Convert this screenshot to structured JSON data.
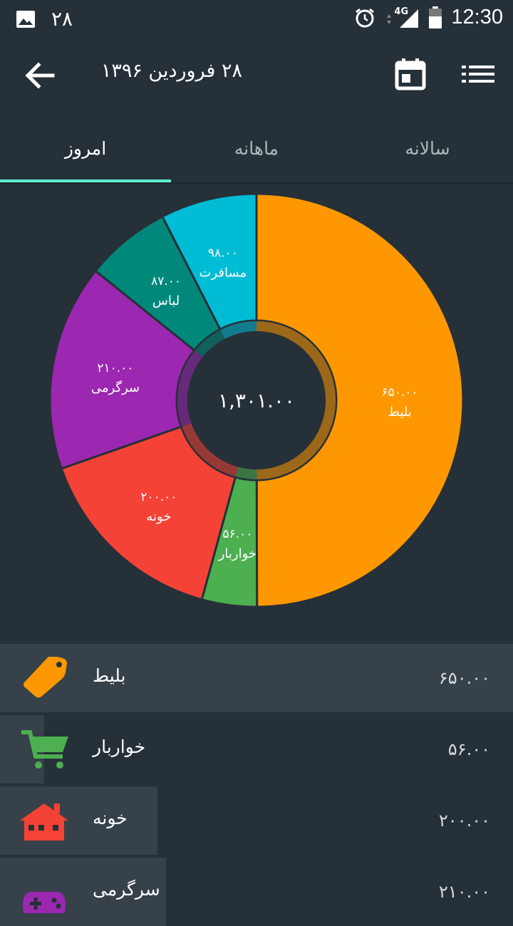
{
  "status_bar": {
    "notification_count": "۲۸",
    "network": "4G",
    "time": "12:30"
  },
  "app_bar": {
    "title": "۲۸ فروردین ۱۳۹۶"
  },
  "tabs": [
    {
      "label": "امروز",
      "active": true
    },
    {
      "label": "ماهانه",
      "active": false
    },
    {
      "label": "سالانه",
      "active": false
    }
  ],
  "chart_data": {
    "type": "pie",
    "center_label": "۱,۳۰۱.۰۰",
    "slices": [
      {
        "label": "بلیط",
        "value_label": "۶۵۰.۰۰",
        "value": 650,
        "color": "#FF9800"
      },
      {
        "label": "خواربار",
        "value_label": "۵۶.۰۰",
        "value": 56,
        "color": "#4CAF50"
      },
      {
        "label": "خونه",
        "value_label": "۲۰۰.۰۰",
        "value": 200,
        "color": "#F44336"
      },
      {
        "label": "سرگرمی",
        "value_label": "۲۱۰.۰۰",
        "value": 210,
        "color": "#9C27B0"
      },
      {
        "label": "لباس",
        "value_label": "۸۷.۰۰",
        "value": 87,
        "color": "#00897B"
      },
      {
        "label": "مسافرت",
        "value_label": "۹۸.۰۰",
        "value": 98,
        "color": "#00BCD4"
      }
    ]
  },
  "list": [
    {
      "label": "بلیط",
      "value": "۶۵۰.۰۰",
      "icon": "tag-icon",
      "color": "#FF9800",
      "highlight": 1.0
    },
    {
      "label": "خواربار",
      "value": "۵۶.۰۰",
      "icon": "cart-icon",
      "color": "#4CAF50",
      "highlight": 0.086
    },
    {
      "label": "خونه",
      "value": "۲۰۰.۰۰",
      "icon": "house-icon",
      "color": "#F44336",
      "highlight": 0.307
    },
    {
      "label": "سرگرمی",
      "value": "۲۱۰.۰۰",
      "icon": "gamepad-icon",
      "color": "#9C27B0",
      "highlight": 0.323
    }
  ]
}
